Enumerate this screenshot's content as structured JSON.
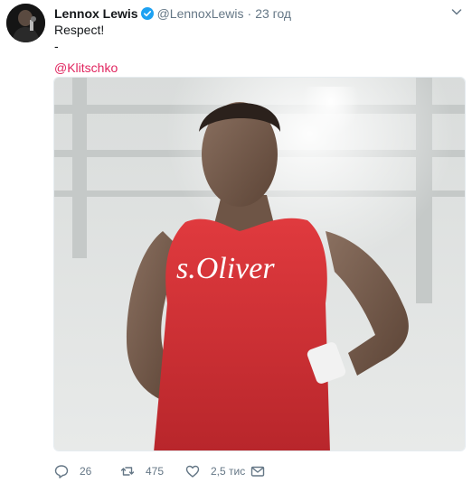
{
  "tweet": {
    "author_name": "Lennox Lewis",
    "handle": "@LennoxLewis",
    "separator": "·",
    "time": "23 год",
    "text_lines": [
      "Respect!",
      "-"
    ],
    "mention": "@Klitschko",
    "shirt_text": "s.Oliver",
    "counts": {
      "replies": "26",
      "retweets": "475",
      "likes": "2,5 тис"
    },
    "icons": {
      "verified": "verified-badge-icon",
      "caret": "chevron-down-icon",
      "reply": "reply-icon",
      "retweet": "retweet-icon",
      "like": "heart-icon",
      "dm": "envelope-icon"
    },
    "colors": {
      "link": "#e0245e",
      "verified": "#1da1f2",
      "muted": "#657786",
      "text": "#14171a"
    }
  }
}
